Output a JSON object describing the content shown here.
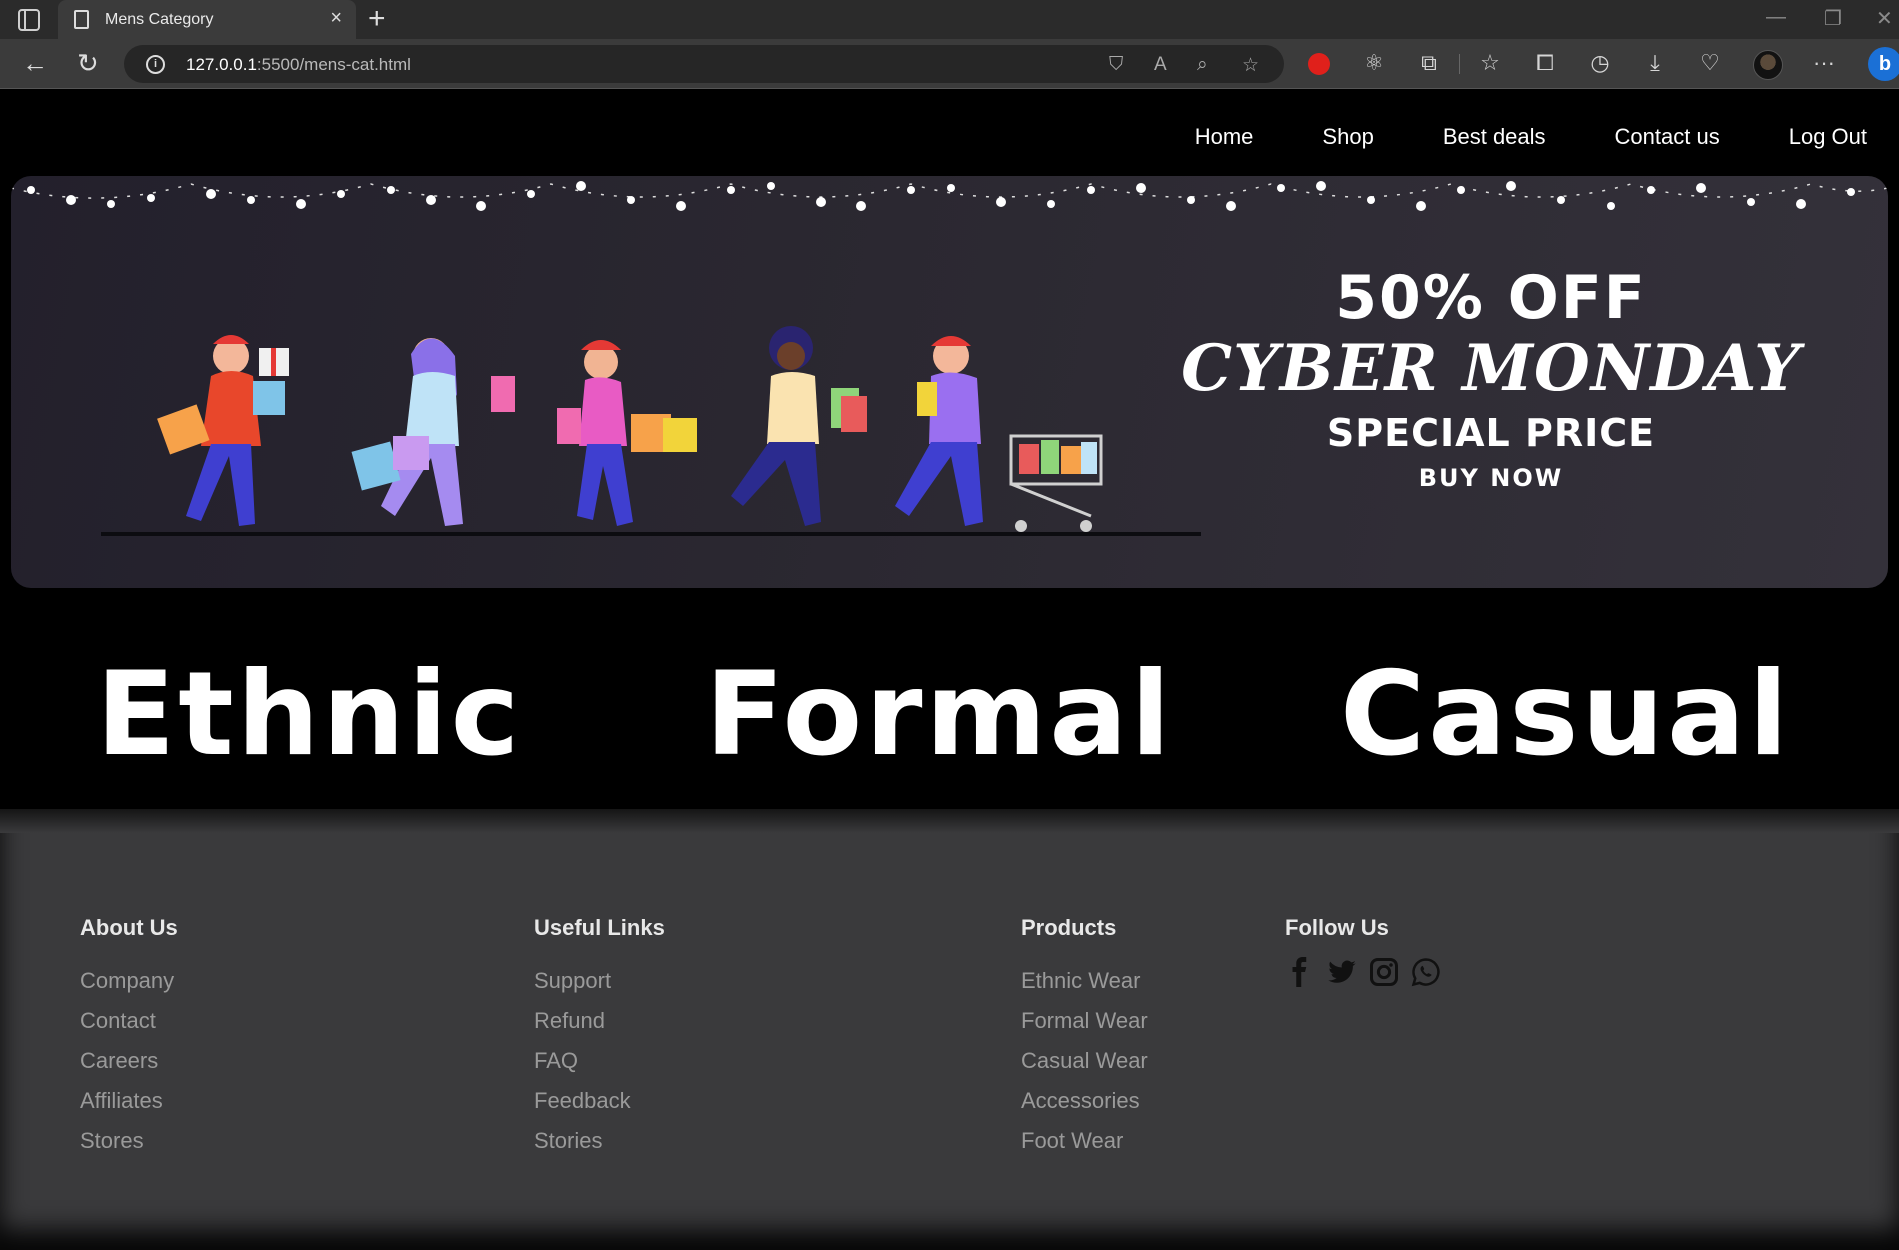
{
  "browser": {
    "tab_title": "Mens Category",
    "tab_close": "×",
    "new_tab": "+",
    "url_host": "127.0.0.1",
    "url_rest": ":5500/mens-cat.html",
    "window_controls": [
      "minimize-icon",
      "restore-icon",
      "close-icon"
    ],
    "toolbar_icons": [
      "tracking-prevention-icon",
      "read-aloud-icon",
      "zoom-icon",
      "add-favorite-icon",
      "adblock-icon",
      "extension-react-icon",
      "extensions-icon",
      "favorites-icon",
      "collections-icon",
      "history-icon",
      "downloads-icon",
      "browser-essentials-icon",
      "profile-avatar",
      "more-icon",
      "bing-copilot-icon"
    ]
  },
  "nav": {
    "items": [
      "Home",
      "Shop",
      "Best deals",
      "Contact us",
      "Log Out"
    ]
  },
  "hero": {
    "line1": "50% OFF",
    "line2": "CYBER MONDAY",
    "line3": "SPECIAL PRICE",
    "line4": "BUY NOW",
    "slides": 3,
    "active_slide": 1
  },
  "categories": [
    "Ethnic",
    "Formal",
    "Casual"
  ],
  "footer": {
    "about": {
      "title": "About Us",
      "links": [
        "Company",
        "Contact",
        "Careers",
        "Affiliates",
        "Stores"
      ]
    },
    "useful": {
      "title": "Useful Links",
      "links": [
        "Support",
        "Refund",
        "FAQ",
        "Feedback",
        "Stories"
      ]
    },
    "products": {
      "title": "Products",
      "links": [
        "Ethnic Wear",
        "Formal Wear",
        "Casual Wear",
        "Accessories",
        "Foot Wear"
      ]
    },
    "follow": {
      "title": "Follow Us",
      "icons": [
        "facebook-icon",
        "twitter-icon",
        "instagram-icon",
        "whatsapp-icon"
      ]
    }
  },
  "colors": {
    "page_bg": "#000000",
    "footer_bg": "#3a3a3c",
    "footer_link": "#9a9a9a",
    "chrome_bg": "#2b2b2b"
  }
}
